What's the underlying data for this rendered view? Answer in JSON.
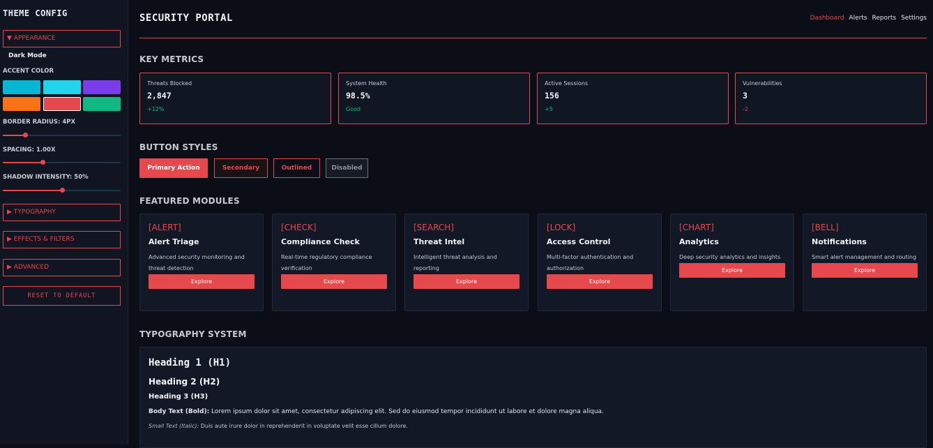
{
  "sidebar": {
    "title": "THEME CONFIG",
    "appearance": "▼ APPEARANCE",
    "dark_mode": "Dark Mode",
    "accent_label": "ACCENT COLOR",
    "accent_colors": [
      "#06b6d4",
      "#22d3ee",
      "#7c3aed",
      "#f97316",
      "#e5484d",
      "#10b981"
    ],
    "accent_selected": "#e5484d",
    "border_radius_label": "BORDER RADIUS: 4PX",
    "border_radius_level": 0.19,
    "spacing_label": "SPACING: 1.00X",
    "spacing_level": 0.34,
    "shadow_label": "SHADOW INTENSITY: 50%",
    "shadow_level": 0.5,
    "typography": "▶ TYPOGRAPHY",
    "effects": "▶ EFFECTS & FILTERS",
    "advanced": "▶ ADVANCED",
    "reset": "RESET TO DEFAULT"
  },
  "header": {
    "title": "SECURITY PORTAL",
    "nav": [
      "Dashboard",
      "Alerts",
      "Reports",
      "Settings"
    ],
    "active_nav": "Dashboard"
  },
  "sections": {
    "metrics": "KEY METRICS",
    "buttons": "BUTTON STYLES",
    "modules": "FEATURED MODULES",
    "typography": "TYPOGRAPHY SYSTEM"
  },
  "metrics": [
    {
      "label": "Threats Blocked",
      "value": "2,847",
      "delta": "+12%",
      "delta_color": "#10b981"
    },
    {
      "label": "System Health",
      "value": "98.5%",
      "delta": "Good",
      "delta_color": "#10b981"
    },
    {
      "label": "Active Sessions",
      "value": "156",
      "delta": "+5",
      "delta_color": "#10b981"
    },
    {
      "label": "Vulnerabilities",
      "value": "3",
      "delta": "-2",
      "delta_color": "#e5484d"
    }
  ],
  "buttons": {
    "primary": "Primary Action",
    "secondary": "Secondary",
    "outlined": "Outlined",
    "disabled": "Disabled"
  },
  "modules": [
    {
      "icon": "[ALERT]",
      "name": "Alert Triage",
      "desc": "Advanced security monitoring and threat detection",
      "cta": "Explore"
    },
    {
      "icon": "[CHECK]",
      "name": "Compliance Check",
      "desc": "Real-time regulatory compliance verification",
      "cta": "Explore"
    },
    {
      "icon": "[SEARCH]",
      "name": "Threat Intel",
      "desc": "Intelligent threat analysis and reporting",
      "cta": "Explore"
    },
    {
      "icon": "[LOCK]",
      "name": "Access Control",
      "desc": "Multi-factor authentication and authorization",
      "cta": "Explore"
    },
    {
      "icon": "[CHART]",
      "name": "Analytics",
      "desc": "Deep security analytics and insights",
      "cta": "Explore"
    },
    {
      "icon": "[BELL]",
      "name": "Notifications",
      "desc": "Smart alert management and routing",
      "cta": "Explore"
    }
  ],
  "typography": {
    "h1": "Heading 1 (H1)",
    "h2": "Heading 2 (H2)",
    "h3": "Heading 3 (H3)",
    "body_label": "Body Text (Bold):",
    "body_text": " Lorem ipsum dolor sit amet, consectetur adipiscing elit. Sed do eiusmod tempor incididunt ut labore et dolore magna aliqua.",
    "small_label": "Small Text (Italic):",
    "small_text": " Duis aute irure dolor in reprehenderit in voluptate velit esse cillum dolore."
  }
}
